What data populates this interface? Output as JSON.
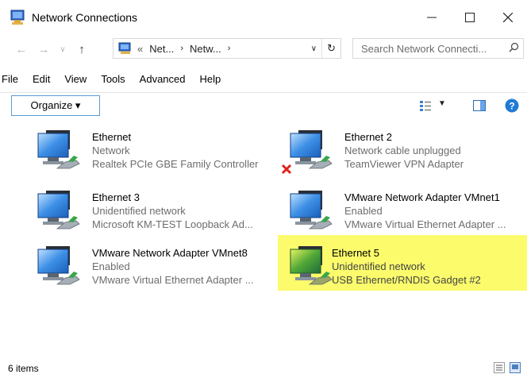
{
  "window": {
    "title": "Network Connections"
  },
  "address": {
    "overflow": "«",
    "crumbs": [
      "Net...",
      "Netw..."
    ]
  },
  "search": {
    "placeholder": "Search Network Connecti..."
  },
  "menu": [
    "File",
    "Edit",
    "View",
    "Tools",
    "Advanced",
    "Help"
  ],
  "toolbar": {
    "organize_label": "Organize ▾"
  },
  "items": [
    {
      "name": "Ethernet",
      "status": "Network",
      "device": "Realtek PCIe GBE Family Controller",
      "disabled": false,
      "selected": false
    },
    {
      "name": "Ethernet 2",
      "status": "Network cable unplugged",
      "device": "TeamViewer VPN Adapter",
      "disabled": true,
      "selected": false
    },
    {
      "name": "Ethernet 3",
      "status": "Unidentified network",
      "device": "Microsoft KM-TEST Loopback Ad...",
      "disabled": false,
      "selected": false
    },
    {
      "name": "VMware Network Adapter VMnet1",
      "status": "Enabled",
      "device": "VMware Virtual Ethernet Adapter ...",
      "disabled": false,
      "selected": false
    },
    {
      "name": "VMware Network Adapter VMnet8",
      "status": "Enabled",
      "device": "VMware Virtual Ethernet Adapter ...",
      "disabled": false,
      "selected": false
    },
    {
      "name": "Ethernet 5",
      "status": "Unidentified network",
      "device": "USB Ethernet/RNDIS Gadget #2",
      "disabled": false,
      "selected": true
    }
  ],
  "status": {
    "count_text": "6 items"
  },
  "colors": {
    "selection": "#fbfb6c",
    "accent": "#1f7bd6",
    "secondary_text": "#6d6d6d"
  }
}
